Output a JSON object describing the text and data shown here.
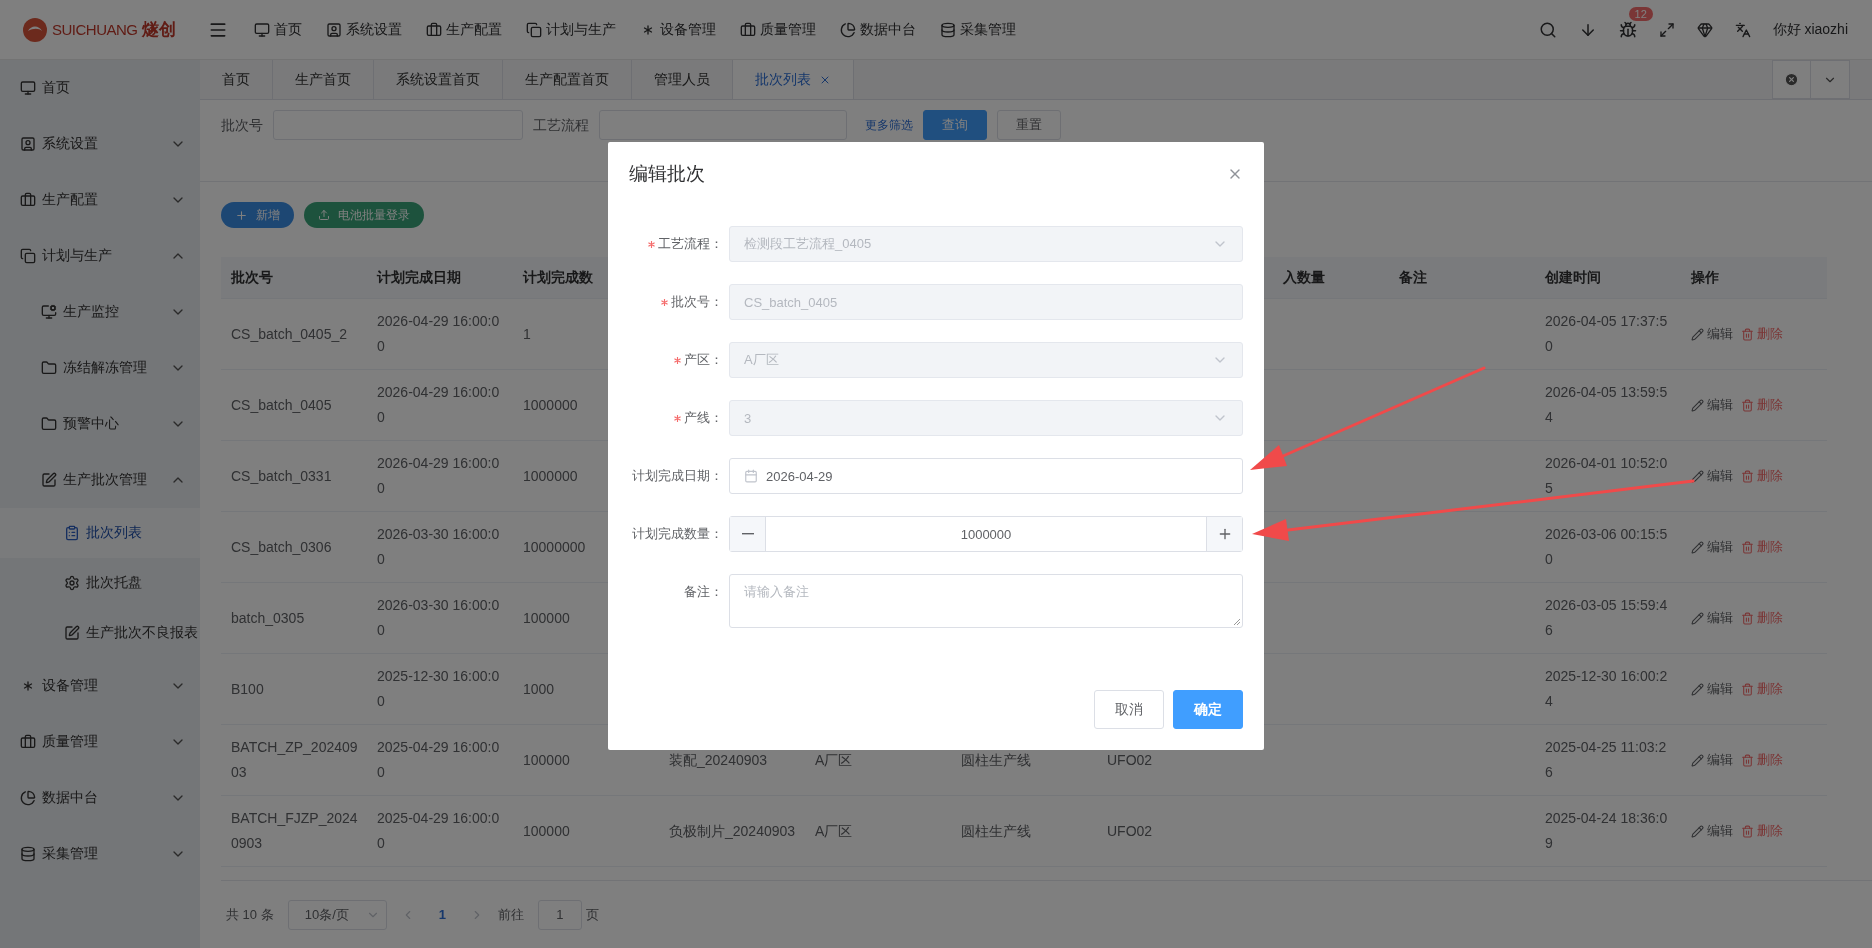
{
  "header": {
    "logo": {
      "latin": "SUICHUANG",
      "cjk": "燧创"
    },
    "nav": [
      "首页",
      "系统设置",
      "生产配置",
      "计划与生产",
      "设备管理",
      "质量管理",
      "数据中台",
      "采集管理"
    ],
    "notification_count": "12",
    "greeting": "你好 xiaozhi"
  },
  "sidebar": {
    "items": [
      {
        "label": "首页",
        "selected": false
      },
      {
        "label": "系统设置",
        "selected": false,
        "expanded": false
      },
      {
        "label": "生产配置",
        "selected": false,
        "expanded": false
      },
      {
        "label": "计划与生产",
        "selected": false,
        "expanded": true,
        "children": [
          {
            "label": "生产监控",
            "selected": false,
            "expanded": false
          },
          {
            "label": "冻结解冻管理",
            "selected": false,
            "expanded": false
          },
          {
            "label": "预警中心",
            "selected": false,
            "expanded": false
          },
          {
            "label": "生产批次管理",
            "selected": false,
            "expanded": true,
            "children": [
              {
                "label": "批次列表",
                "selected": true
              },
              {
                "label": "批次托盘",
                "selected": false
              },
              {
                "label": "生产批次不良报表",
                "selected": false
              }
            ]
          }
        ]
      },
      {
        "label": "设备管理",
        "selected": false,
        "expanded": false
      },
      {
        "label": "质量管理",
        "selected": false,
        "expanded": false
      },
      {
        "label": "数据中台",
        "selected": false,
        "expanded": false
      },
      {
        "label": "采集管理",
        "selected": false,
        "expanded": false
      }
    ]
  },
  "tabs": [
    {
      "label": "首页",
      "selected": false,
      "closable": false
    },
    {
      "label": "生产首页",
      "selected": false,
      "closable": false
    },
    {
      "label": "系统设置首页",
      "selected": false,
      "closable": false
    },
    {
      "label": "生产配置首页",
      "selected": false,
      "closable": false
    },
    {
      "label": "管理人员",
      "selected": false,
      "closable": false
    },
    {
      "label": "批次列表",
      "selected": true,
      "closable": true
    }
  ],
  "filters": {
    "batch_label": "批次号",
    "process_label": "工艺流程",
    "more_link": "更多筛选",
    "search_button": "查询",
    "reset_button": "重置"
  },
  "toolbar": {
    "add_button": "新增",
    "import_button": "电池批量登录"
  },
  "table": {
    "columns_left": [
      "批次号",
      "计划完成日期",
      "计划完成数"
    ],
    "columns_right": [
      "入数量",
      "备注",
      "创建时间",
      "操作"
    ],
    "rows": [
      {
        "leading": [
          "CS_batch_0405_2",
          "2026-04-29 16:00:00",
          "1"
        ],
        "created": "2026-04-05 17:37:50",
        "edit": "编辑",
        "delete": "删除"
      },
      {
        "leading": [
          "CS_batch_0405",
          "2026-04-29 16:00:00",
          "1000000"
        ],
        "created": "2026-04-05 13:59:54",
        "edit": "编辑",
        "delete": "删除"
      },
      {
        "leading": [
          "CS_batch_0331",
          "2026-04-29 16:00:00",
          "1000000"
        ],
        "created": "2026-04-01 10:52:05",
        "edit": "编辑",
        "delete": "删除"
      },
      {
        "leading": [
          "CS_batch_0306",
          "2026-03-30 16:00:00",
          "10000000"
        ],
        "created": "2026-03-06 00:15:50",
        "edit": "编辑",
        "delete": "删除"
      },
      {
        "leading": [
          "batch_0305",
          "2026-03-30 16:00:00",
          "100000"
        ],
        "created": "2026-03-05 15:59:46",
        "edit": "编辑",
        "delete": "删除"
      },
      {
        "leading": [
          "B100",
          "2025-12-30 16:00:00",
          "1000"
        ],
        "created": "2025-12-30 16:00:24",
        "edit": "编辑",
        "delete": "删除"
      },
      {
        "leading": [
          "BATCH_ZP_20240903",
          "2025-04-29 16:00:00",
          "100000"
        ],
        "middle": [
          "装配_20240903",
          "A厂区",
          "圆柱生产线",
          "UFO02"
        ],
        "created": "2025-04-25 11:03:26",
        "edit": "编辑",
        "delete": "删除"
      },
      {
        "leading": [
          "BATCH_FJZP_20240903",
          "2025-04-29 16:00:00",
          "100000"
        ],
        "middle": [
          "负极制片_20240903",
          "A厂区",
          "圆柱生产线",
          "UFO02"
        ],
        "created": "2025-04-24 18:36:09",
        "edit": "编辑",
        "delete": "删除"
      }
    ]
  },
  "pagination": {
    "total": "共 10 条",
    "page_size": "10条/页",
    "pages": [
      {
        "label": "1",
        "selected": true
      }
    ],
    "goto_label": "前往",
    "goto_value": "1",
    "page_suffix": "页"
  },
  "dialog": {
    "title": "编辑批次",
    "fields": [
      {
        "kind": "select",
        "label": "工艺流程：",
        "required": true,
        "disabled": true,
        "value": "检测段工艺流程_0405"
      },
      {
        "kind": "input",
        "label": "批次号：",
        "required": true,
        "disabled": true,
        "value": "CS_batch_0405"
      },
      {
        "kind": "select",
        "label": "产区：",
        "required": true,
        "disabled": true,
        "value": "A厂区"
      },
      {
        "kind": "select",
        "label": "产线：",
        "required": true,
        "disabled": true,
        "value": "3"
      },
      {
        "kind": "date",
        "label": "计划完成日期：",
        "required": false,
        "disabled": false,
        "value": "2026-04-29"
      },
      {
        "kind": "number",
        "label": "计划完成数量：",
        "required": false,
        "disabled": false,
        "value": "1000000"
      },
      {
        "kind": "textarea",
        "label": "备注：",
        "required": false,
        "disabled": false,
        "placeholder": "请输入备注"
      }
    ],
    "cancel_button": "取消",
    "confirm_button": "确定"
  }
}
